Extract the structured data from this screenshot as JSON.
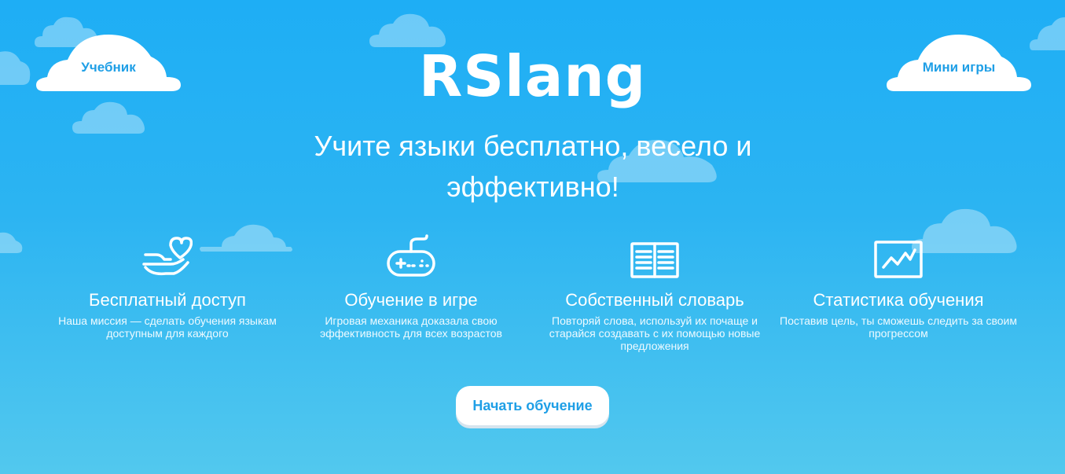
{
  "header": {
    "nav_left": "Учебник",
    "nav_right": "Мини игры",
    "brand": "RSlang"
  },
  "hero": {
    "tagline": "Учите языки бесплатно, весело и эффективно!"
  },
  "features": [
    {
      "icon": "heart-hand-icon",
      "title": "Бесплатный доступ",
      "description": "Наша миссия — сделать обучения языкам доступным для каждого"
    },
    {
      "icon": "gamepad-icon",
      "title": "Обучение в игре",
      "description": "Игровая механика доказала свою эффективность для всех возрастов"
    },
    {
      "icon": "open-book-icon",
      "title": "Собственный словарь",
      "description": "Повторяй слова, используй их почаще и старайся создавать с их помощью новые предложения"
    },
    {
      "icon": "chart-icon",
      "title": "Статистика обучения",
      "description": "Поставив цель, ты сможешь следить за своим прогрессом"
    }
  ],
  "cta": {
    "label": "Начать обучение"
  },
  "colors": {
    "background_top": "#1eaef5",
    "background_bottom": "#52c8ee",
    "accent": "#1f9fe6",
    "text": "#ffffff"
  }
}
